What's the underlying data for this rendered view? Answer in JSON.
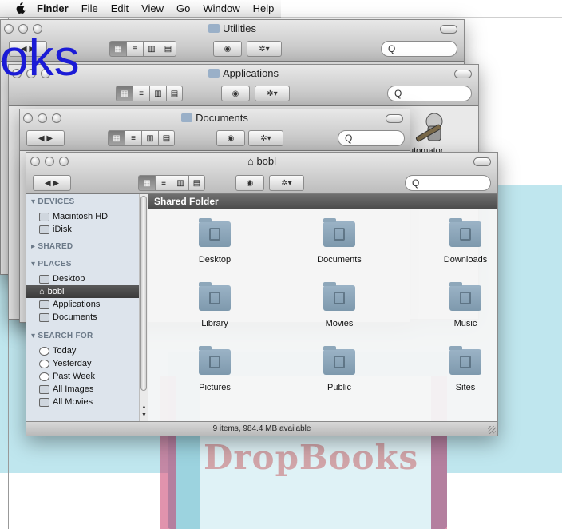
{
  "menubar": {
    "items": [
      "Finder",
      "File",
      "Edit",
      "View",
      "Go",
      "Window",
      "Help"
    ]
  },
  "overlay_text": "oks",
  "watermark": "DropBooks",
  "windows": {
    "utilities": {
      "title": "Utilities",
      "search_value": "Q"
    },
    "applications": {
      "title": "Applications",
      "search_value": "Q"
    },
    "documents": {
      "title": "Documents",
      "search_value": "Q",
      "header_fragment": "Shared Folder",
      "sidebar_fragment": "DEVICES"
    },
    "front": {
      "title": "bobl",
      "search_value": "Q",
      "content_header": "Shared Folder",
      "status": "9 items, 984.4 MB available"
    }
  },
  "behind_item": {
    "label": "Automator",
    "visible_label": "utomator"
  },
  "sidebar": {
    "devices_header": "DEVICES",
    "devices": [
      "Macintosh HD",
      "iDisk"
    ],
    "shared_header": "SHARED",
    "places_header": "PLACES",
    "places": [
      "Desktop",
      "bobl",
      "Applications",
      "Documents"
    ],
    "search_header": "SEARCH FOR",
    "searches": [
      "Today",
      "Yesterday",
      "Past Week",
      "All Images",
      "All Movies"
    ]
  },
  "folders": [
    {
      "name": "Desktop"
    },
    {
      "name": "Documents"
    },
    {
      "name": "Downloads"
    },
    {
      "name": "Library"
    },
    {
      "name": "Movies"
    },
    {
      "name": "Music"
    },
    {
      "name": "Pictures"
    },
    {
      "name": "Public"
    },
    {
      "name": "Sites"
    }
  ],
  "icons": {
    "back": "◀",
    "forward": "▶",
    "eye": "◉",
    "gear": "✲▾",
    "apple": "apple-logo"
  }
}
